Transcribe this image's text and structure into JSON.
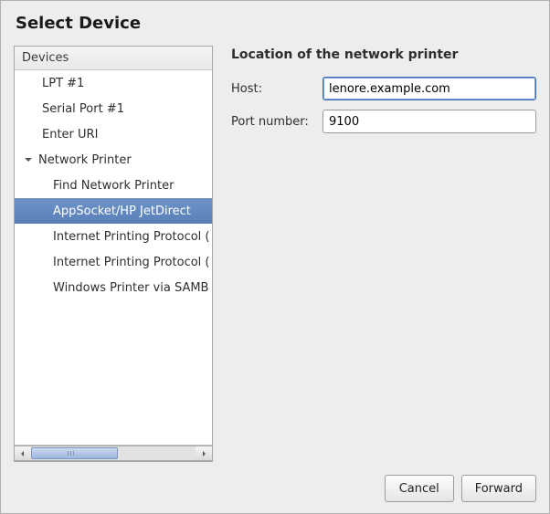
{
  "title": "Select Device",
  "devices": {
    "header": "Devices",
    "items": [
      {
        "label": "LPT #1",
        "level": 0,
        "selected": false,
        "expander": false
      },
      {
        "label": "Serial Port #1",
        "level": 0,
        "selected": false,
        "expander": false
      },
      {
        "label": "Enter URI",
        "level": 0,
        "selected": false,
        "expander": false
      },
      {
        "label": "Network Printer",
        "level": 0,
        "selected": false,
        "expander": true,
        "expanded": true
      },
      {
        "label": "Find Network Printer",
        "level": 1,
        "selected": false,
        "expander": false
      },
      {
        "label": "AppSocket/HP JetDirect",
        "level": 1,
        "selected": true,
        "expander": false
      },
      {
        "label": "Internet Printing Protocol (",
        "level": 1,
        "selected": false,
        "expander": false
      },
      {
        "label": "Internet Printing Protocol (",
        "level": 1,
        "selected": false,
        "expander": false
      },
      {
        "label": "Windows Printer via SAMB",
        "level": 1,
        "selected": false,
        "expander": false
      }
    ]
  },
  "form": {
    "section_title": "Location of the network printer",
    "host_label": "Host:",
    "host_value": "lenore.example.com",
    "port_label": "Port number:",
    "port_value": "9100"
  },
  "buttons": {
    "cancel": "Cancel",
    "forward": "Forward"
  }
}
